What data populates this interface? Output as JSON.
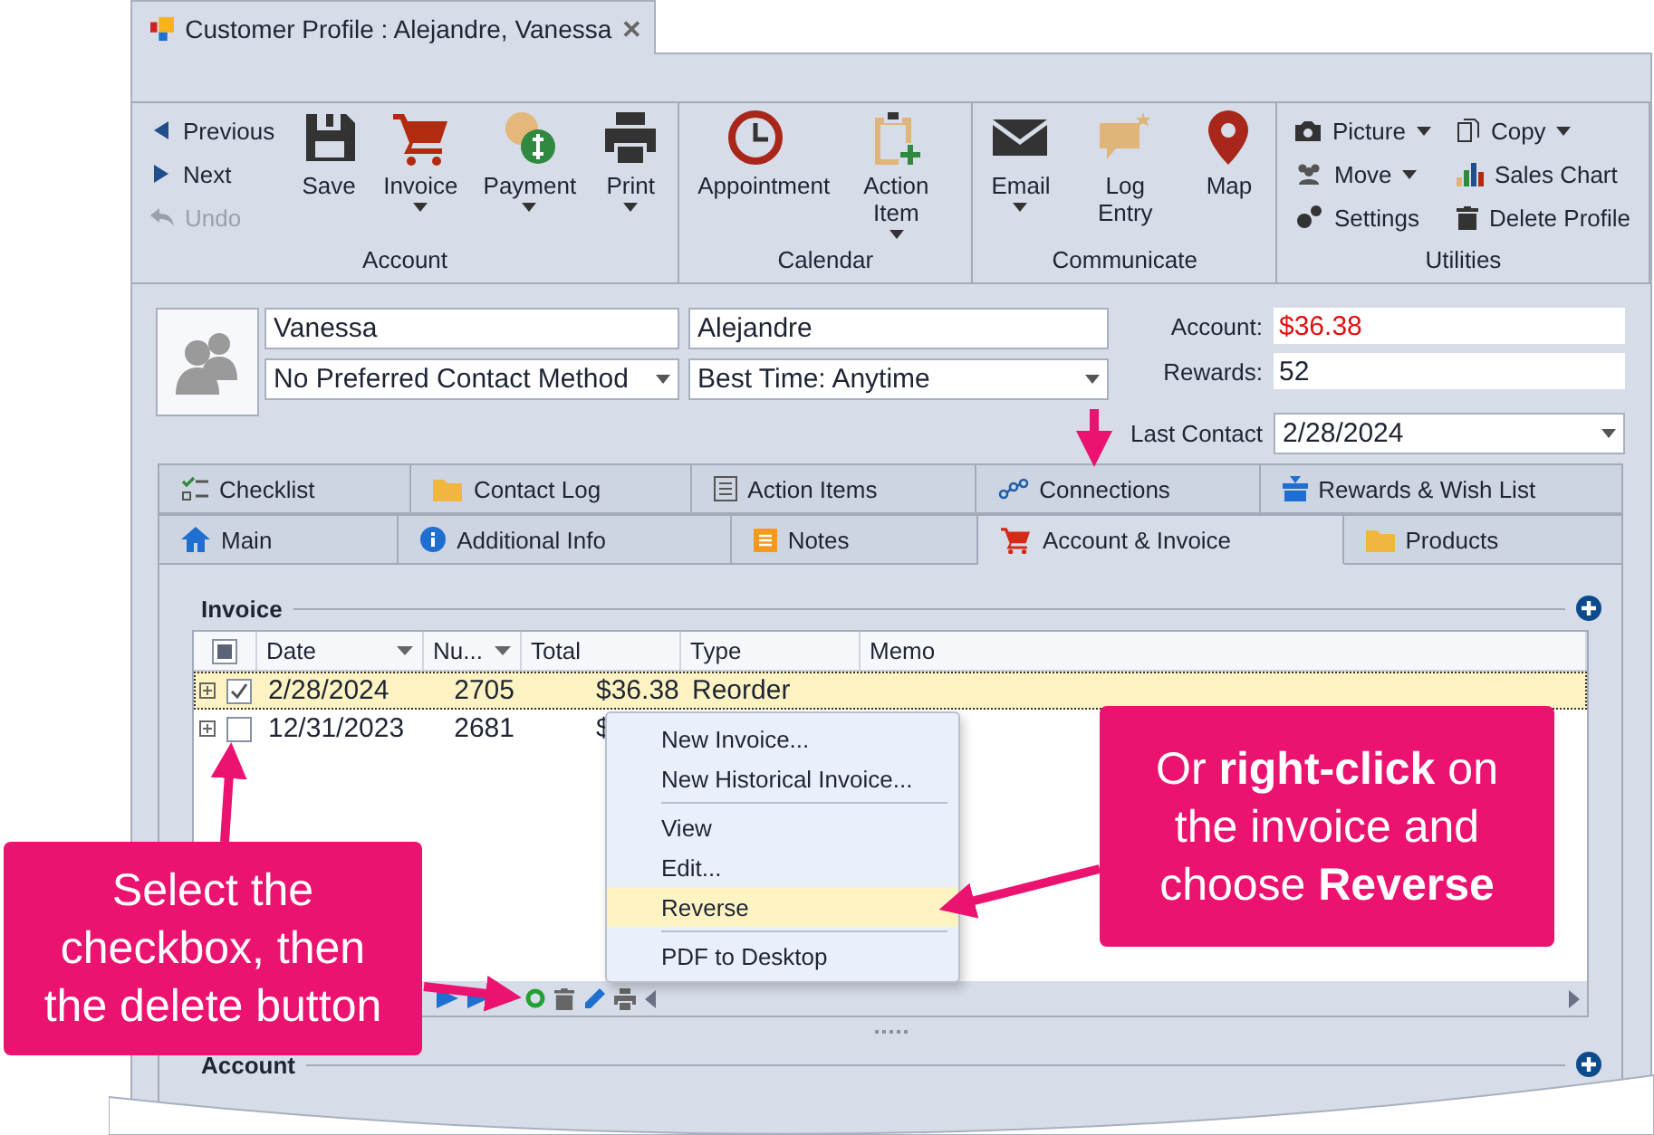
{
  "window": {
    "title": "Customer Profile : Alejandre, Vanessa"
  },
  "ribbon": [
    {
      "label": "Account",
      "items": [
        {
          "kind": "small",
          "label": "Previous",
          "disabled": false,
          "dropdown": false
        },
        {
          "kind": "small",
          "label": "Next",
          "disabled": false,
          "dropdown": false
        },
        {
          "kind": "small",
          "label": "Undo",
          "disabled": true,
          "dropdown": false
        },
        {
          "kind": "large",
          "label": "Save",
          "disabled": false,
          "dropdown": false
        },
        {
          "kind": "large",
          "label": "Invoice",
          "disabled": false,
          "dropdown": true
        },
        {
          "kind": "large",
          "label": "Payment",
          "disabled": false,
          "dropdown": true
        },
        {
          "kind": "large",
          "label": "Print",
          "disabled": false,
          "dropdown": true
        }
      ]
    },
    {
      "label": "Calendar",
      "items": [
        {
          "kind": "large",
          "label": "Appointment",
          "disabled": false,
          "dropdown": false
        },
        {
          "kind": "large",
          "label": "Action Item",
          "disabled": false,
          "dropdown": true
        }
      ]
    },
    {
      "label": "Communicate",
      "items": [
        {
          "kind": "large",
          "label": "Email",
          "disabled": false,
          "dropdown": true
        },
        {
          "kind": "large",
          "label": "Log Entry",
          "disabled": false,
          "dropdown": false
        },
        {
          "kind": "large",
          "label": "Map",
          "disabled": false,
          "dropdown": false
        }
      ]
    },
    {
      "label": "Utilities",
      "items": [
        {
          "kind": "small",
          "label": "Picture",
          "disabled": false,
          "dropdown": true
        },
        {
          "kind": "small",
          "label": "Move",
          "disabled": false,
          "dropdown": true
        },
        {
          "kind": "small",
          "label": "Settings",
          "disabled": false,
          "dropdown": false
        },
        {
          "kind": "small",
          "label": "Copy",
          "disabled": false,
          "dropdown": true
        },
        {
          "kind": "small",
          "label": "Sales Chart",
          "disabled": false,
          "dropdown": false
        },
        {
          "kind": "small",
          "label": "Delete Profile",
          "disabled": false,
          "dropdown": false
        }
      ]
    }
  ],
  "profile": {
    "first_name": "Vanessa",
    "last_name": "Alejandre",
    "contact_method": "No Preferred Contact Method",
    "best_time": "Best Time: Anytime",
    "account_label": "Account:",
    "account_value": "$36.38",
    "rewards_label": "Rewards:",
    "rewards_value": "52",
    "last_contact_label": "Last Contact",
    "last_contact_value": "2/28/2024"
  },
  "tab_rows": [
    {
      "tabs": [
        {
          "label": "Checklist",
          "selected": false
        },
        {
          "label": "Contact Log",
          "selected": false
        },
        {
          "label": "Action Items",
          "selected": false
        },
        {
          "label": "Connections",
          "selected": false
        },
        {
          "label": "Rewards & Wish List",
          "selected": false
        }
      ]
    },
    {
      "tabs": [
        {
          "label": "Main",
          "selected": false
        },
        {
          "label": "Additional Info",
          "selected": false
        },
        {
          "label": "Notes",
          "selected": false
        },
        {
          "label": "Account & Invoice",
          "selected": true
        },
        {
          "label": "Products",
          "selected": false
        }
      ]
    }
  ],
  "invoice": {
    "title": "Invoice",
    "select_all_partial": true,
    "columns": [
      {
        "label": "Date",
        "filter": true
      },
      {
        "label": "Nu...",
        "filter": true
      },
      {
        "label": "Total",
        "filter": false
      },
      {
        "label": "Type",
        "filter": false
      },
      {
        "label": "Memo",
        "filter": false
      }
    ],
    "rows": [
      {
        "date": "2/28/2024",
        "number": "2705",
        "total": "$36.38",
        "type": "Reorder",
        "checked": true,
        "selected": true
      },
      {
        "date": "12/31/2023",
        "number": "2681",
        "total": "$",
        "checked": false,
        "selected": false
      }
    ]
  },
  "account_section": {
    "title": "Account"
  },
  "context_menu": {
    "items": [
      {
        "label": "New Invoice...",
        "separator_before": false,
        "selected": false
      },
      {
        "label": "New Historical Invoice...",
        "separator_before": false,
        "selected": false
      },
      {
        "label": "View",
        "separator_before": true,
        "selected": false
      },
      {
        "label": "Edit...",
        "separator_before": false,
        "selected": false
      },
      {
        "label": "Reverse",
        "separator_before": false,
        "selected": true
      },
      {
        "label": "PDF to Desktop",
        "separator_before": true,
        "selected": false
      }
    ]
  },
  "callouts": [
    {
      "text": "Select the checkbox, then the delete button"
    },
    {
      "text": "Or **right-click** on the invoice and choose **Reverse**"
    }
  ]
}
